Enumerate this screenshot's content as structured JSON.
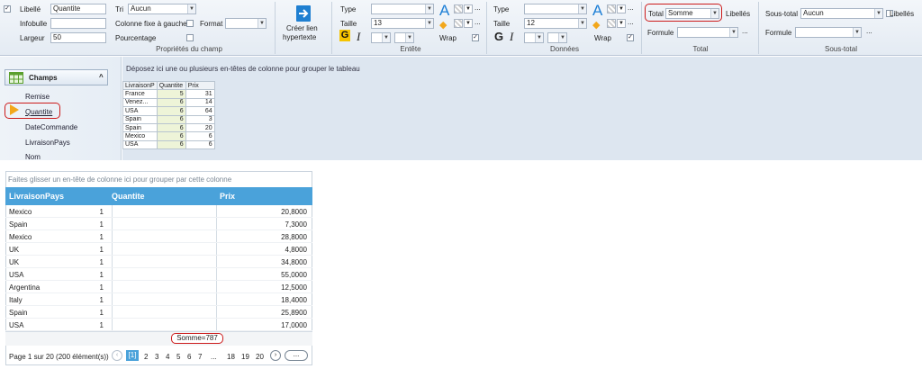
{
  "ribbon": {
    "libelle_label": "Libellé",
    "libelle_value": "Quantite",
    "infobulle_label": "Infobulle",
    "infobulle_value": "",
    "largeur_label": "Largeur",
    "largeur_value": "50",
    "tri_label": "Tri",
    "tri_value": "Aucun",
    "colonne_fixe_label": "Colonne fixe à gauche",
    "format_label": "Format",
    "format_value": "",
    "pourcentage_label": "Pourcentage",
    "group_proprietes": "Propriétés du champ",
    "creer_lien": "Créer lien",
    "hypertexte": "hypertexte",
    "entete": {
      "type_label": "Type",
      "taille_label": "Taille",
      "taille_value": "13",
      "wrap_label": "Wrap",
      "group": "Entête"
    },
    "donnees": {
      "type_label": "Type",
      "taille_label": "Taille",
      "taille_value": "12",
      "wrap_label": "Wrap",
      "group": "Données"
    },
    "total": {
      "total_label": "Total",
      "total_value": "Somme",
      "libelles_label": "Libellés",
      "formule_label": "Formule",
      "group": "Total"
    },
    "soustotal": {
      "label": "Sous-total",
      "value": "Aucun",
      "libelles_label": "Libellés",
      "formule_label": "Formule",
      "group": "Sous-total"
    },
    "bold_glyph": "G",
    "italic_glyph": "I",
    "font_glyph": "A",
    "ellipsis": "..."
  },
  "champs": {
    "title": "Champs",
    "items": [
      "Remise",
      "Quantite",
      "DateCommande",
      "LivraisonPays",
      "Nom"
    ]
  },
  "dropzone": {
    "text": "Déposez ici une ou plusieurs en-têtes de colonne pour grouper le tableau"
  },
  "mini_grid": {
    "headers": [
      "LivraisonP",
      "Quantite",
      "Prix"
    ],
    "rows": [
      [
        "France",
        "5",
        "31"
      ],
      [
        "Venez...",
        "6",
        "14"
      ],
      [
        "USA",
        "6",
        "64"
      ],
      [
        "Spain",
        "6",
        "3"
      ],
      [
        "Spain",
        "6",
        "20"
      ],
      [
        "Mexico",
        "6",
        "6"
      ],
      [
        "USA",
        "6",
        "6"
      ]
    ]
  },
  "grid": {
    "group_hint": "Faites glisser un en-tête de colonne ici pour grouper par cette colonne",
    "headers": [
      "LivraisonPays",
      "Quantite",
      "Prix"
    ],
    "rows": [
      [
        "Mexico",
        "1",
        "20,8000"
      ],
      [
        "Spain",
        "1",
        "7,3000"
      ],
      [
        "Mexico",
        "1",
        "28,8000"
      ],
      [
        "UK",
        "1",
        "4,8000"
      ],
      [
        "UK",
        "1",
        "34,8000"
      ],
      [
        "USA",
        "1",
        "55,0000"
      ],
      [
        "Argentina",
        "1",
        "12,5000"
      ],
      [
        "Italy",
        "1",
        "18,4000"
      ],
      [
        "Spain",
        "1",
        "25,8900"
      ],
      [
        "USA",
        "1",
        "17,0000"
      ]
    ],
    "summary": "Somme=787",
    "pager_text": "Page 1 sur 20 (200 élément(s))",
    "pages": [
      "[1]",
      "2",
      "3",
      "4",
      "5",
      "6",
      "7",
      "...",
      "18",
      "19",
      "20"
    ],
    "more_label": "..."
  },
  "colors": {
    "header_blue": "#4aa2da",
    "highlight_red": "#cc1b1b",
    "arrow_orange": "#f2a71b"
  }
}
